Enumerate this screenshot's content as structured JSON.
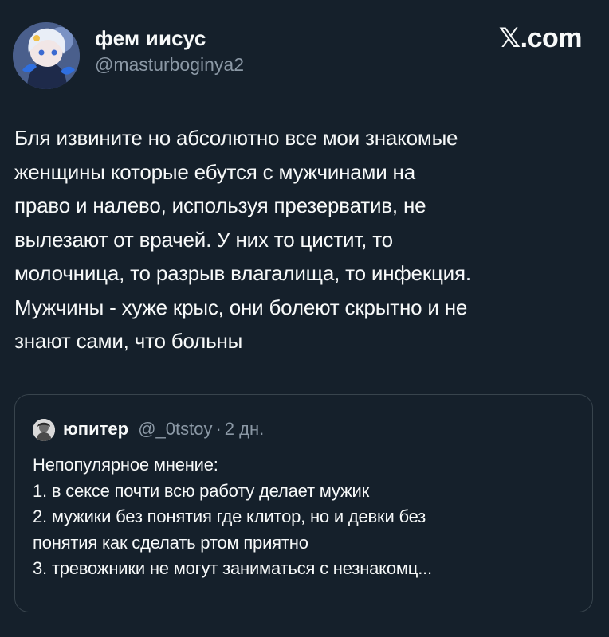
{
  "author": {
    "display_name": "фем иисус",
    "handle": "@masturboginya2",
    "avatar_icon": "anime-character-avatar-icon"
  },
  "brand": {
    "x_glyph": "𝕏",
    "suffix": ".com"
  },
  "tweet": {
    "text": "Бля извините но абсолютно все мои знакомые\nженщины которые ебутся с мужчинами на\nправо и налево, используя презерватив, не\nвылезают от врачей. У них то цистит, то\nмолочница, то разрыв влагалища, то инфекция.\nМужчины - хуже крыс, они болеют скрытно и не\nзнают сами, что больны"
  },
  "quote": {
    "avatar_icon": "user-avatar-icon",
    "name": "юпитер",
    "handle": "@_0tstoy",
    "separator": "·",
    "time": "2 дн.",
    "text": "Непопулярное мнение:\n1. в сексе почти всю работу делает мужик\n2. мужики без понятия где клитор, но и девки без\nпонятия как сделать ртом приятно\n3. тревожники не могут заниматься с незнакомц..."
  },
  "colors": {
    "background": "#15202b",
    "text_primary": "#f7f9f9",
    "text_secondary": "#8b98a5",
    "border": "#38444d"
  }
}
